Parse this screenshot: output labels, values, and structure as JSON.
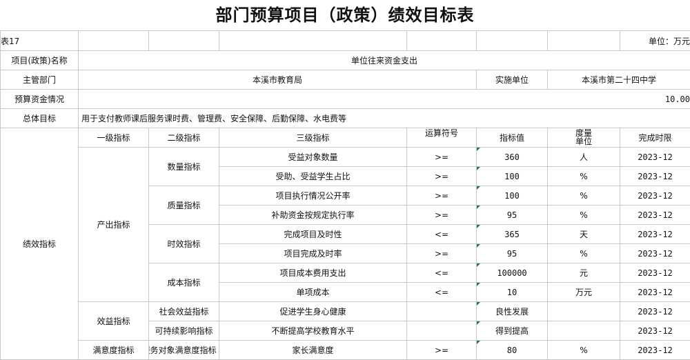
{
  "title": "部门预算项目（政策）绩效目标表",
  "sheet_label": "表17",
  "unit_label": "单位：万元",
  "project_name_label": "项目(政策)名称",
  "project_name": "单位往来资金支出",
  "dept_label": "主管部门",
  "dept": "本溪市教育局",
  "impl_label": "实施单位",
  "impl": "本溪市第二十四中学",
  "budget_label": "预算资金情况",
  "budget": "10.00",
  "goal_label": "总体目标",
  "goal": "用于支付教师课后服务课时费、管理费、安全保障、后勤保障、水电费等",
  "perf_label": "绩效指标",
  "headers": {
    "l1": "一级指标",
    "l2": "二级指标",
    "l3": "三级指标",
    "op": "运算符号",
    "val": "指标值",
    "unit": "度量单位",
    "due": "完成时限"
  },
  "groups": {
    "output": "产出指标",
    "benefit": "效益指标",
    "satisfaction": "满意度指标",
    "quantity": "数量指标",
    "quality": "质量指标",
    "timeliness": "时效指标",
    "cost": "成本指标",
    "social": "社会效益指标",
    "sustain": "可持续影响指标",
    "service": "服务对象满意度指标"
  },
  "rows": [
    {
      "name": "受益对象数量",
      "op": ">=",
      "value": "360",
      "unit": "人",
      "due": "2023-12"
    },
    {
      "name": "受助、受益学生占比",
      "op": ">=",
      "value": "100",
      "unit": "%",
      "due": "2023-12"
    },
    {
      "name": "项目执行情况公开率",
      "op": ">=",
      "value": "100",
      "unit": "%",
      "due": "2023-12"
    },
    {
      "name": "补助资金按规定执行率",
      "op": ">=",
      "value": "95",
      "unit": "%",
      "due": "2023-12"
    },
    {
      "name": "完成项目及时性",
      "op": "<=",
      "value": "365",
      "unit": "天",
      "due": "2023-12"
    },
    {
      "name": "项目完成及时率",
      "op": ">=",
      "value": "95",
      "unit": "%",
      "due": "2023-12"
    },
    {
      "name": "项目成本费用支出",
      "op": "<=",
      "value": "100000",
      "unit": "元",
      "due": "2023-12"
    },
    {
      "name": "单项成本",
      "op": "<=",
      "value": "10",
      "unit": "万元",
      "due": "2023-12"
    },
    {
      "name": "促进学生身心健康",
      "op": "",
      "value": "良性发展",
      "unit": "",
      "due": "2023-12"
    },
    {
      "name": "不断提高学校教育水平",
      "op": "",
      "value": "得到提高",
      "unit": "",
      "due": "2023-12"
    },
    {
      "name": "家长满意度",
      "op": ">=",
      "value": "80",
      "unit": "%",
      "due": "2023-12"
    }
  ]
}
